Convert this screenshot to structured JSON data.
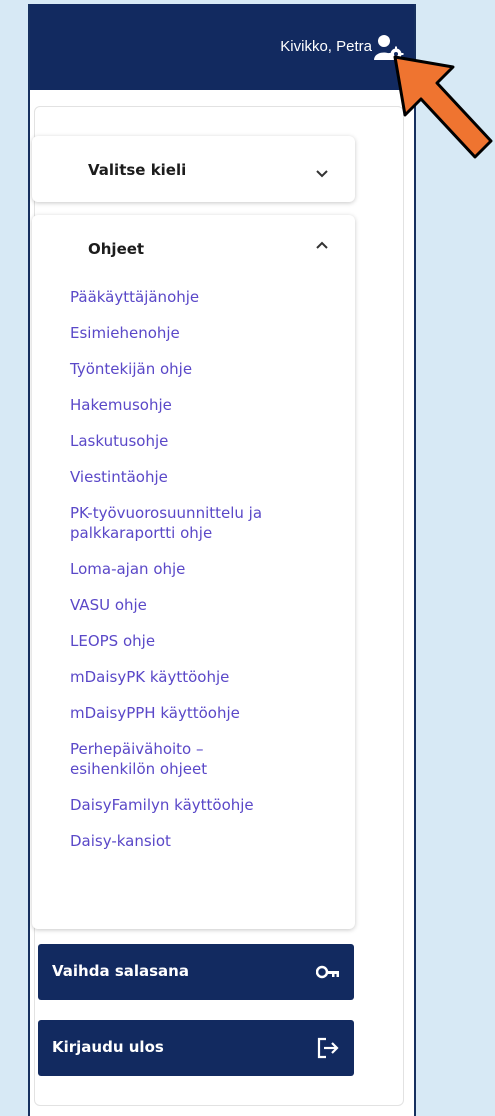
{
  "header": {
    "user_name": "Kivikko, Petra",
    "icon": "user-settings-icon",
    "background": "#122a60"
  },
  "language_card": {
    "title": "Valitse kieli",
    "icon": "chevron-down-icon",
    "expanded": false
  },
  "help_card": {
    "title": "Ohjeet",
    "icon": "chevron-up-icon",
    "expanded": true,
    "links": [
      "Pääkäyttäjänohje",
      "Esimiehenohje",
      "Työntekijän ohje",
      "Hakemusohje",
      "Laskutusohje",
      "Viestintäohje",
      "PK-työvuorosuunnittelu ja palkkaraportti ohje",
      "Loma-ajan ohje",
      "VASU ohje",
      "LEOPS ohje",
      "mDaisyPK käyttöohje",
      "mDaisyPPH käyttöohje",
      "Perhepäivähoito – esihenkilön ohjeet",
      "DaisyFamilyn käyttöohje",
      "Daisy-kansiot"
    ],
    "link_color": "#5a48c8"
  },
  "actions": {
    "change_password": {
      "label": "Vaihda salasana",
      "icon": "key-icon"
    },
    "logout": {
      "label": "Kirjaudu ulos",
      "icon": "logout-icon"
    }
  },
  "overlay": {
    "icon": "pointer-arrow-icon",
    "color": "#ef7430"
  }
}
